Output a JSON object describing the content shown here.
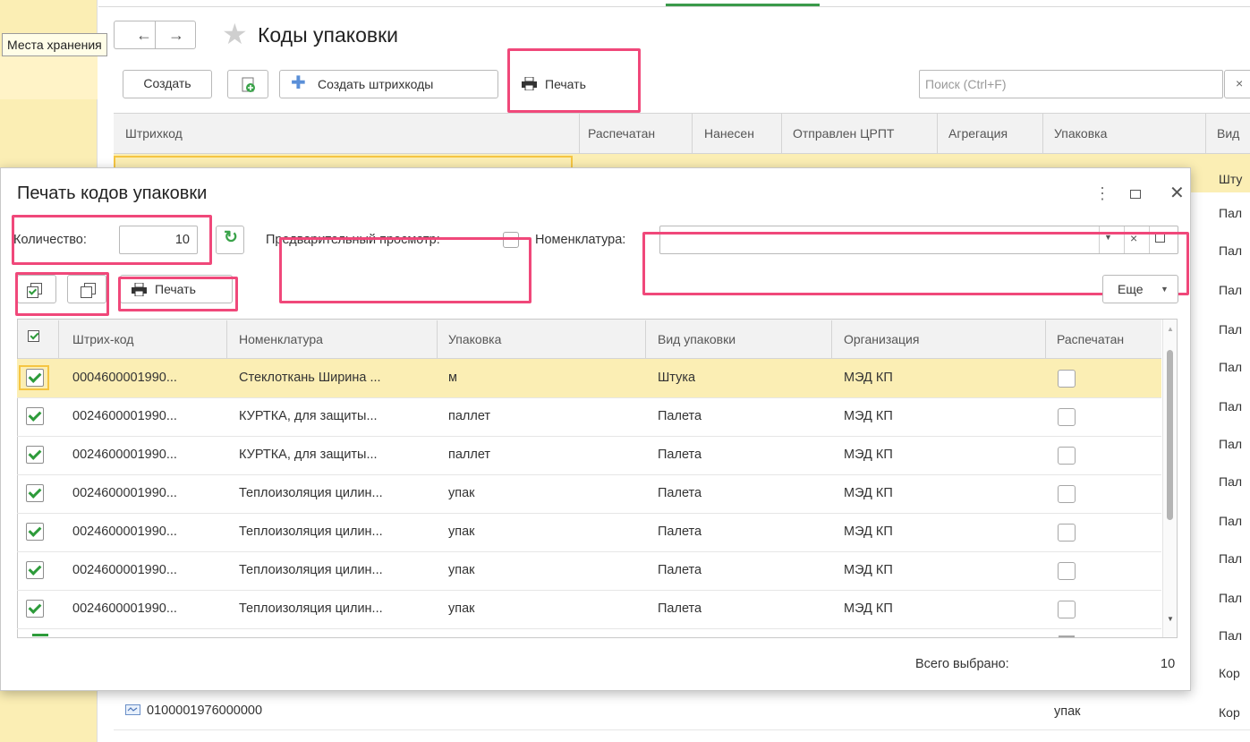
{
  "tooltip": "Места хранения",
  "main": {
    "title": "Коды упаковки",
    "toolbar": {
      "create": "Создать",
      "create_barcodes": "Создать штрихкоды",
      "print": "Печать",
      "search_placeholder": "Поиск (Ctrl+F)"
    },
    "columns": [
      "Штрихкод",
      "Распечатан",
      "Нанесен",
      "Отправлен ЦРПТ",
      "Агрегация",
      "Упаковка",
      "Вид"
    ],
    "right_col_values": [
      "Шту",
      "Пал",
      "Пал",
      "Пал",
      "Пал",
      "Пал",
      "Пал",
      "Пал",
      "Пал",
      "Пал",
      "Пал",
      "Пал",
      "Пал",
      "Кор",
      "Кор"
    ],
    "bottom_row": {
      "barcode": "0100001976000000",
      "pack": "упак"
    }
  },
  "dialog": {
    "title": "Печать кодов упаковки",
    "quantity_label": "Количество:",
    "quantity_value": "10",
    "preview_label": "Предварительный просмотр:",
    "nomenclature_label": "Номенклатура:",
    "print_label": "Печать",
    "more_label": "Еще",
    "columns": [
      "Штрих-код",
      "Номенклатура",
      "Упаковка",
      "Вид упаковки",
      "Организация",
      "Распечатан"
    ],
    "rows": [
      {
        "barcode": "0004600001990...",
        "nom": "Стеклоткань Ширина ...",
        "pack": "м",
        "kind": "Штука",
        "org": "МЭД КП"
      },
      {
        "barcode": "0024600001990...",
        "nom": "КУРТКА, для защиты...",
        "pack": "паллет",
        "kind": "Палета",
        "org": "МЭД КП"
      },
      {
        "barcode": "0024600001990...",
        "nom": "КУРТКА, для защиты...",
        "pack": "паллет",
        "kind": "Палета",
        "org": "МЭД КП"
      },
      {
        "barcode": "0024600001990...",
        "nom": "Теплоизоляция цилин...",
        "pack": "упак",
        "kind": "Палета",
        "org": "МЭД КП"
      },
      {
        "barcode": "0024600001990...",
        "nom": "Теплоизоляция цилин...",
        "pack": "упак",
        "kind": "Палета",
        "org": "МЭД КП"
      },
      {
        "barcode": "0024600001990...",
        "nom": "Теплоизоляция цилин...",
        "pack": "упак",
        "kind": "Палета",
        "org": "МЭД КП"
      },
      {
        "barcode": "0024600001990...",
        "nom": "Теплоизоляция цилин...",
        "pack": "упак",
        "kind": "Палета",
        "org": "МЭД КП"
      }
    ],
    "total_label": "Всего выбрано:",
    "total_value": "10"
  },
  "colors": {
    "highlight": "#f0487a",
    "selected_row": "#fbeeb4",
    "check": "#2d9b3a"
  }
}
